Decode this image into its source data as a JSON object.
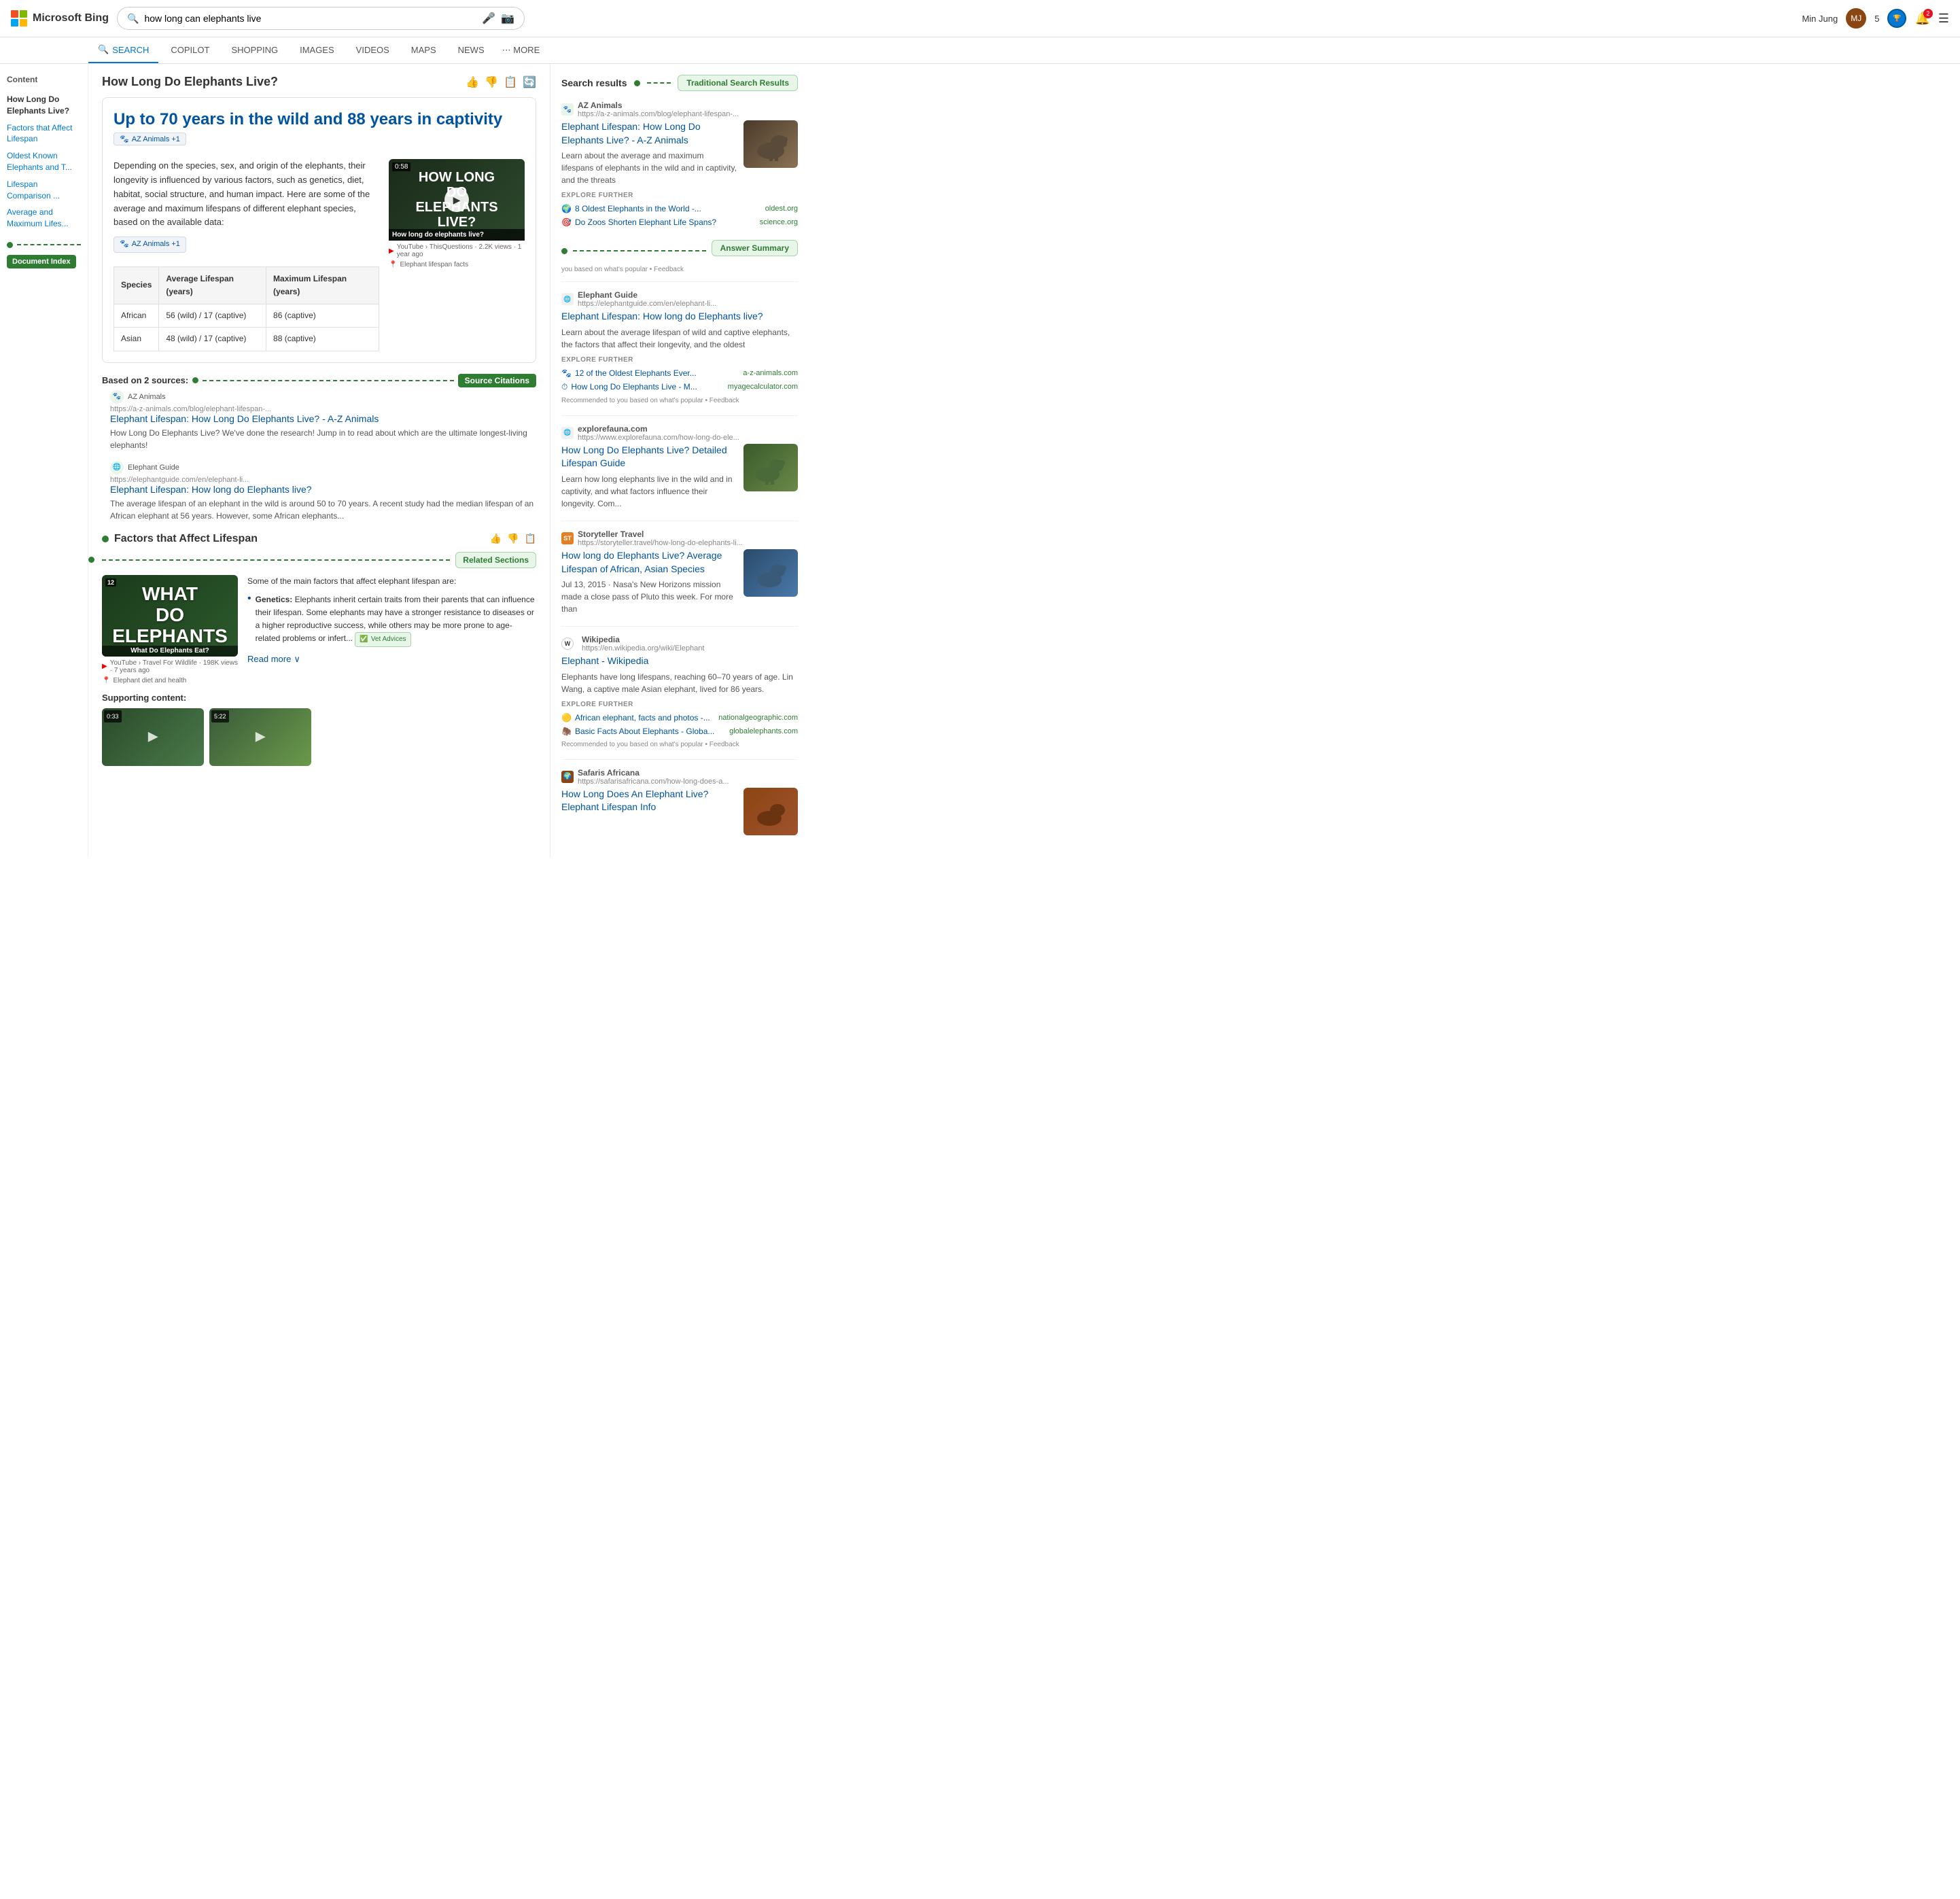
{
  "header": {
    "logo_text": "Microsoft Bing",
    "search_query": "how long can elephants live",
    "user_name": "Min Jung",
    "user_points": "5",
    "notif_count": "2"
  },
  "nav": {
    "tabs": [
      {
        "id": "search",
        "label": "SEARCH",
        "active": true
      },
      {
        "id": "copilot",
        "label": "COPILOT",
        "active": false
      },
      {
        "id": "shopping",
        "label": "SHOPPING",
        "active": false
      },
      {
        "id": "images",
        "label": "IMAGES",
        "active": false
      },
      {
        "id": "videos",
        "label": "VIDEOS",
        "active": false
      },
      {
        "id": "maps",
        "label": "MAPS",
        "active": false
      },
      {
        "id": "news",
        "label": "NEWS",
        "active": false
      },
      {
        "id": "more",
        "label": "⋯ MORE",
        "active": false
      }
    ]
  },
  "sidebar": {
    "title": "Content",
    "items": [
      {
        "id": "how-long",
        "label": "How Long Do Elephants Live?",
        "active": true
      },
      {
        "id": "factors",
        "label": "Factors that Affect Lifespan"
      },
      {
        "id": "oldest",
        "label": "Oldest Known Elephants and T..."
      },
      {
        "id": "comparison",
        "label": "Lifespan Comparison ..."
      },
      {
        "id": "average",
        "label": "Average and Maximum Lifes..."
      }
    ],
    "doc_index_label": "Document Index"
  },
  "main": {
    "page_title": "How Long Do Elephants Live?",
    "answer_headline": "Up to 70 years in the wild and 88 years in captivity",
    "source_badge": "AZ Animals +1",
    "answer_text": "Depending on the species, sex, and origin of the elephants, their longevity is influenced by various factors, such as genetics, diet, habitat, social structure, and human impact. Here are some of the average and maximum lifespans of different elephant species, based on the available data:",
    "video": {
      "duration": "0:58",
      "title": "How long do elephants live?",
      "platform": "YouTube",
      "channel": "ThisQuestions",
      "views": "2.2K views",
      "time_ago": "1 year ago",
      "location_label": "Elephant lifespan facts"
    },
    "table": {
      "headers": [
        "Species",
        "Average Lifespan (years)",
        "Maximum Lifespan (years)"
      ],
      "rows": [
        [
          "African",
          "56 (wild) / 17 (captive)",
          "86 (captive)"
        ],
        [
          "Asian",
          "48 (wild) / 17 (captive)",
          "88 (captive)"
        ]
      ]
    },
    "sources_label": "Based on 2 sources:",
    "source_citations_label": "Source Citations",
    "sources": [
      {
        "icon": "🐾",
        "name": "AZ Animals",
        "url": "https://a-z-animals.com/blog/elephant-lifespan-...",
        "title": "Elephant Lifespan: How Long Do Elephants Live? - A-Z Animals",
        "desc": "How Long Do Elephants Live? We've done the research! Jump in to read about which are the ultimate longest-living elephants!"
      },
      {
        "icon": "🌐",
        "name": "Elephant Guide",
        "url": "https://elephantguide.com/en/elephant-li...",
        "title": "Elephant Lifespan: How long do Elephants live?",
        "desc": "The average lifespan of an elephant in the wild is around 50 to 70 years. A recent study had the median lifespan of an African elephant at 56 years. However, some African elephants..."
      }
    ],
    "factors_section": {
      "title": "Factors that Affect Lifespan",
      "video": {
        "number": "12",
        "title_art": "WHAT DO ELEPHANTS",
        "overlay": "What Do Elephants Eat?",
        "platform": "YouTube",
        "channel": "Travel For Wildlife",
        "views": "198K views",
        "time_ago": "7 years ago",
        "location": "Elephant diet and health"
      },
      "text_intro": "Some of the main factors that affect elephant lifespan are:",
      "bullets": [
        {
          "term": "Genetics:",
          "desc": "Elephants inherit certain traits from their parents that can influence their lifespan. Some elephants may have a stronger resistance to diseases or a higher reproductive success, while others may be more prone to age-related problems or infert..."
        }
      ],
      "vet_badge": "Vet Advices",
      "read_more": "Read more"
    },
    "supporting_label": "Supporting content:",
    "supporting_thumbs": [
      {
        "duration": "0:33",
        "color": "#3a5a3a"
      },
      {
        "duration": "5:22",
        "color": "#4a6a4a"
      }
    ]
  },
  "right_sidebar": {
    "search_results_label": "Search results",
    "tsr_label": "Traditional Search Results",
    "answer_summary_label": "Answer Summary",
    "answer_summary_note": "you based on what's popular • Feedback",
    "related_sections_label": "Related Sections",
    "results": [
      {
        "id": "az-animals",
        "favicon_text": "AZ",
        "favicon_color": "#2e7d32",
        "domain": "AZ Animals",
        "url": "https://a-z-animals.com/blog/elephant-lifespan-...",
        "title": "Elephant Lifespan: How Long Do Elephants Live? - A-Z Animals",
        "desc": "Learn about the average and maximum lifespans of elephants in the wild and in captivity, and the threats",
        "has_image": true,
        "explore": [
          {
            "icon": "🌍",
            "text": "8 Oldest Elephants in the World -...",
            "source": "oldest.org"
          },
          {
            "icon": "🎯",
            "text": "Do Zoos Shorten Elephant Life Spans?",
            "source": "science.org"
          }
        ]
      },
      {
        "id": "elephant-guide",
        "favicon_text": "🌐",
        "favicon_color": "#888",
        "domain": "Elephant Guide",
        "url": "https://elephantguide.com/en/elephant-li...",
        "title": "Elephant Lifespan: How long do Elephants live?",
        "desc": "Learn about the average lifespan of wild and captive elephants, the factors that affect their longevity, and the oldest",
        "has_image": false,
        "explore": [
          {
            "icon": "🐾",
            "text": "12 of the Oldest Elephants Ever...",
            "source": "a-z-animals.com"
          },
          {
            "icon": "⏱",
            "text": "How Long Do Elephants Live - M...",
            "source": "myagecalculator.com"
          }
        ],
        "recommend_note": "Recommended to you based on what's popular • Feedback"
      },
      {
        "id": "explorefauna",
        "favicon_text": "🌐",
        "favicon_color": "#888",
        "domain": "explorefauna.com",
        "url": "https://www.explorefauna.com/how-long-do-ele...",
        "title": "How Long Do Elephants Live? Detailed Lifespan Guide",
        "desc": "Learn how long elephants live in the wild and in captivity, and what factors influence their longevity. Com...",
        "has_image": true
      },
      {
        "id": "storyteller",
        "favicon_text": "ST",
        "favicon_color": "#e67e22",
        "domain": "Storyteller Travel",
        "url": "https://storyteller.travel/how-long-do-elephants-li...",
        "title": "How long do Elephants Live? Average Lifespan of African, Asian Species",
        "desc": "Jul 13, 2015 · Nasa's New Horizons mission made a close pass of Pluto this week. For more than",
        "has_image": true
      },
      {
        "id": "wikipedia",
        "favicon_text": "W",
        "favicon_color": "#fff",
        "domain": "Wikipedia",
        "url": "https://en.wikipedia.org/wiki/Elephant",
        "title": "Elephant - Wikipedia",
        "desc": "Elephants have long lifespans, reaching 60–70 years of age. Lin Wang, a captive male Asian elephant, lived for 86 years.",
        "has_image": false,
        "explore": [
          {
            "icon": "🟡",
            "text": "African elephant, facts and photos -...",
            "source": "nationalgeographic.com"
          },
          {
            "icon": "🦣",
            "text": "Basic Facts About Elephants - Globa...",
            "source": "globalelephants.com"
          }
        ],
        "recommend_note": "Recommended to you based on what's popular • Feedback"
      },
      {
        "id": "safaris-africana",
        "favicon_text": "🌍",
        "favicon_color": "#8B4513",
        "domain": "Safaris Africana",
        "url": "https://safarisafricana.com/how-long-does-a...",
        "title": "How Long Does An Elephant Live? Elephant Lifespan Info",
        "desc": "",
        "has_image": true
      }
    ]
  }
}
